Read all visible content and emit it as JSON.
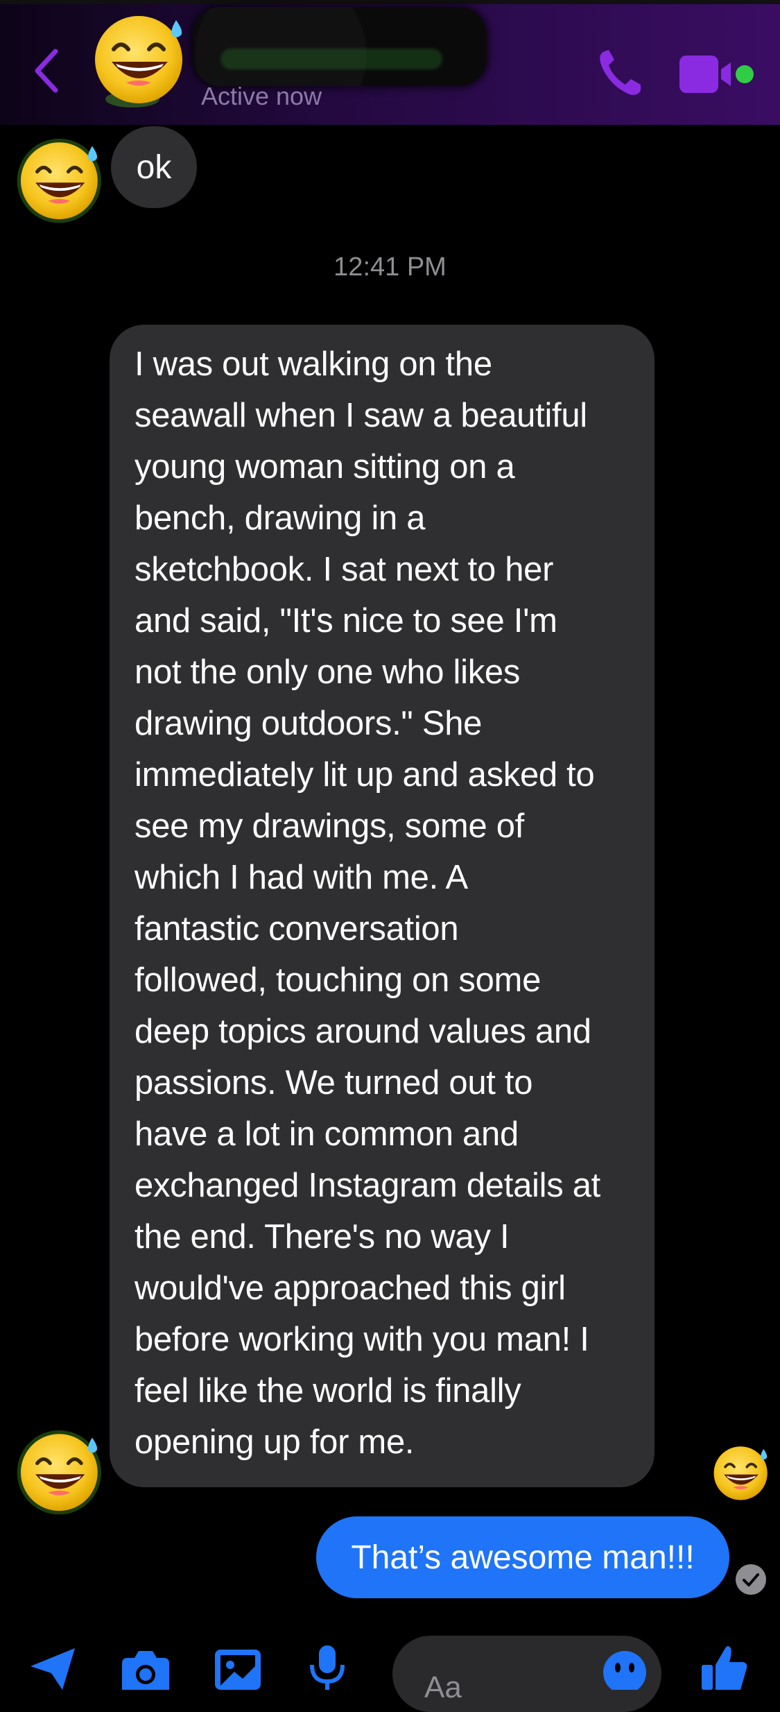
{
  "header": {
    "status": "Active now",
    "back_icon": "chevron-left-icon",
    "call_icon": "phone-icon",
    "video_icon": "video-camera-icon",
    "accent_color": "#8a2be2",
    "online_color": "#31cc46"
  },
  "messages": {
    "received_short": "ok",
    "timestamp": "12:41 PM",
    "received_long_lines": [
      "I was out walking on the",
      "seawall when I saw a beautiful",
      "young woman sitting on a",
      "bench, drawing in a",
      "sketchbook. I sat next to her",
      "and said, \"It's nice to see I'm",
      "not the only one who likes",
      "drawing outdoors.\" She",
      "immediately lit up and asked to",
      "see my drawings, some of",
      "which I had with me. A",
      "fantastic conversation",
      "followed, touching on some",
      "deep topics around values and",
      "passions. We turned out to",
      "have a lot in common and",
      "exchanged Instagram details at",
      "the end. There's no way I",
      "would've approached this girl",
      "before working with you man! I",
      "feel like the world is finally",
      "opening up for me."
    ],
    "sent": "That’s awesome man!!!",
    "avatar_icon": "grinning-sweat-emoji-icon",
    "received_bubble_color": "#2f2f32",
    "sent_bubble_color": "#1f74f7"
  },
  "composer": {
    "placeholder": "Aa",
    "icons": [
      "send-arrow-icon",
      "camera-icon",
      "photo-icon",
      "microphone-icon",
      "emoji-icon",
      "thumbs-up-icon"
    ],
    "icon_color": "#1f74f7"
  }
}
